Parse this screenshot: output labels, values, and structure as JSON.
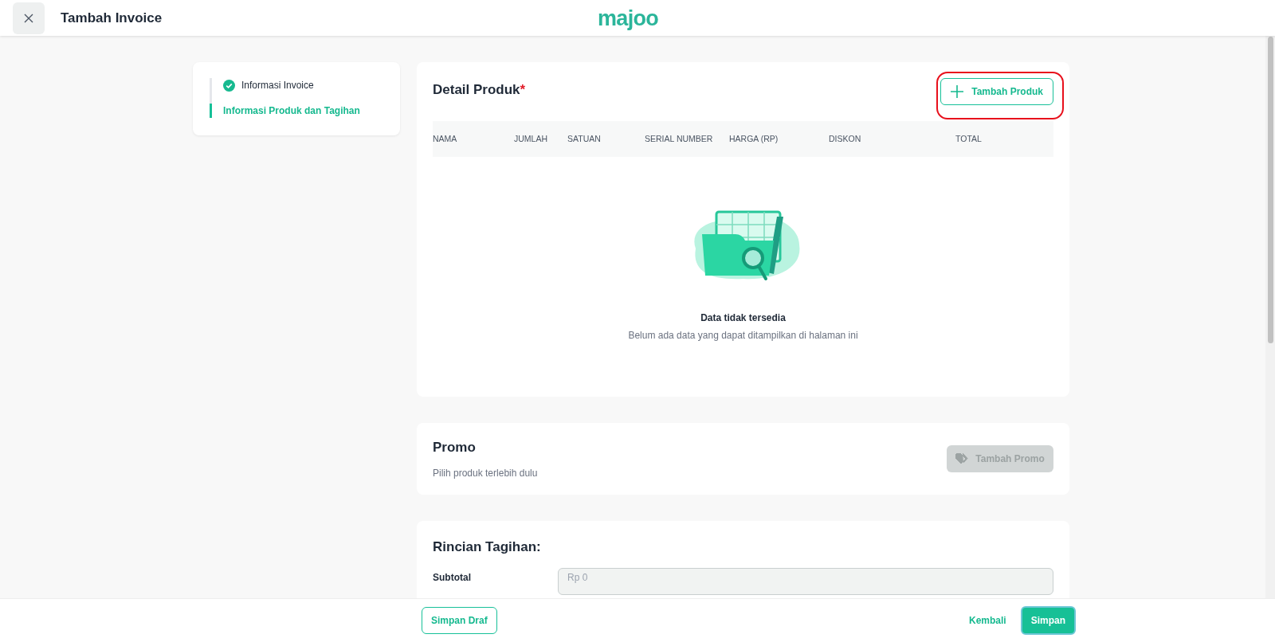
{
  "header": {
    "title": "Tambah Invoice",
    "logo": "majoo"
  },
  "steps": [
    {
      "label": "Informasi Invoice",
      "done": true,
      "selected": false
    },
    {
      "label": "Informasi Produk dan Tagihan",
      "done": false,
      "selected": true
    }
  ],
  "detail_produk": {
    "title": "Detail Produk",
    "required_mark": "*",
    "add_button": "Tambah Produk",
    "highlighted": true,
    "table": {
      "columns": [
        "NAMA",
        "JUMLAH",
        "SATUAN",
        "SERIAL NUMBER",
        "HARGA (RP)",
        "DISKON",
        "TOTAL"
      ]
    },
    "empty_state": {
      "title": "Data tidak tersedia",
      "message": "Belum ada data yang dapat ditampilkan di halaman ini"
    }
  },
  "promo": {
    "title": "Promo",
    "hint": "Pilih produk terlebih dulu",
    "button": {
      "label": "Tambah Promo",
      "disabled": true
    }
  },
  "rincian_tagihan": {
    "title": "Rincian Tagihan:",
    "fields": [
      {
        "label": "Subtotal",
        "placeholder": "Rp 0",
        "disabled": true
      }
    ]
  },
  "footer": {
    "draft_button": "Simpan Draf",
    "back_link": "Kembali",
    "save_button": "Simpan"
  }
}
